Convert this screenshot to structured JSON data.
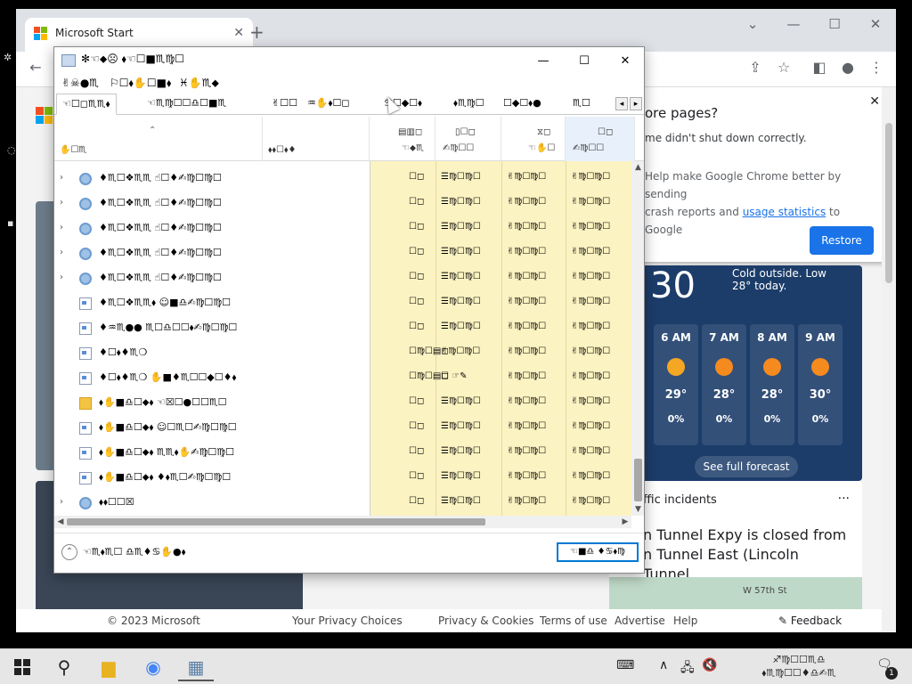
{
  "chrome": {
    "tab_title": "Microsoft Start",
    "tab_close": "✕",
    "new_tab": "+",
    "win_min": "—",
    "win_max": "☐",
    "win_close": "✕",
    "toolbar_back": "←",
    "toolbar_share": "⇪",
    "toolbar_star": "☆",
    "toolbar_sidepanel": "◧",
    "toolbar_profile": "●",
    "toolbar_menu": "⋮"
  },
  "restore_bubble": {
    "title": "ore pages?",
    "text": "me didn't shut down correctly.",
    "text2_a": "Help make Google Chrome better by sending",
    "text2_b": "crash reports and",
    "link": "usage statistics",
    "text2_c": "to Google",
    "close": "✕",
    "restore_label": "Restore"
  },
  "weather": {
    "temp": "30",
    "cold_note": "Cold outside. Low 28° today.",
    "hours": [
      {
        "label": "6 AM",
        "temp": "29°",
        "rain": "0%",
        "icon": "moon",
        "color": "#f5a623"
      },
      {
        "label": "7 AM",
        "temp": "28°",
        "rain": "0%",
        "icon": "sun",
        "color": "#f58a1f"
      },
      {
        "label": "8 AM",
        "temp": "28°",
        "rain": "0%",
        "icon": "sun",
        "color": "#f58a1f"
      },
      {
        "label": "9 AM",
        "temp": "30°",
        "rain": "0%",
        "icon": "sun",
        "color": "#f58a1f"
      }
    ],
    "forecast_label": "See full forecast"
  },
  "traffic": {
    "title": "ffic incidents",
    "dots": "···",
    "headline": "n Tunnel Expy is closed from n Tunnel East (Lincoln Tunnel...",
    "map_label": "W 57th St"
  },
  "footer": {
    "copyright": "© 2023 Microsoft",
    "privacy_choices": "Your Privacy Choices",
    "privacy_cookies": "Privacy & Cookies",
    "terms": "Terms of use",
    "advertise": "Advertise",
    "help": "Help",
    "feedback": "Feedback"
  },
  "dialog": {
    "title": "✻☜⬥☹ ⬧☜☐■♏♍☐",
    "ctrl_min": "—",
    "ctrl_max": "☐",
    "ctrl_close": "✕",
    "menu": [
      "✌☠●♏",
      "⚐☐⬧✋☐■⬧",
      "♓✋♏⬥"
    ],
    "tabs": [
      "☜☐◻♏♏⬧",
      "☜♏♍☐☐♎☐■♏",
      "✌☐☐",
      "♒✋⬧☐◻",
      "♋☐◆☐⬧",
      "⬧♏♍☐",
      "☐◆☐⬧●",
      "♏☐"
    ],
    "tab_left": "◂",
    "tab_right": "▸",
    "headers": {
      "name": "✋☐♏",
      "status": "⬧⬧☐⬧♦",
      "c1_top": "▤▥◻",
      "c1_bot": "☜⬥♏",
      "c2_top": "▯☐◻",
      "c2_bot": "✍♍☐☐",
      "c3_top": "⧖◻",
      "c3_bot": "☜✋☐",
      "c4_top": "☐◻",
      "c4_bot": "✍♍☐☐",
      "sort": "⌃"
    },
    "rows": [
      {
        "icon": "gear",
        "expand": "›",
        "name": "♦♏☐❖♏♏ ☝☐♦✍♍☐♍☐",
        "c1": "☐◻",
        "c2": "☰♍☐♍☐",
        "c3": "✌♍☐♍☐",
        "c4": "✌♍☐♍☐"
      },
      {
        "icon": "gear",
        "expand": "›",
        "name": "♦♏☐❖♏♏ ☝☐♦✍♍☐♍☐",
        "c1": "☐◻",
        "c2": "☰♍☐♍☐",
        "c3": "✌♍☐♍☐",
        "c4": "✌♍☐♍☐"
      },
      {
        "icon": "gear",
        "expand": "›",
        "name": "♦♏☐❖♏♏ ☝☐♦✍♍☐♍☐",
        "c1": "☐◻",
        "c2": "☰♍☐♍☐",
        "c3": "✌♍☐♍☐",
        "c4": "✌♍☐♍☐"
      },
      {
        "icon": "gear",
        "expand": "›",
        "name": "♦♏☐❖♏♏ ☝☐♦✍♍☐♍☐",
        "c1": "☐◻",
        "c2": "☰♍☐♍☐",
        "c3": "✌♍☐♍☐",
        "c4": "✌♍☐♍☐"
      },
      {
        "icon": "gear",
        "expand": "›",
        "name": "♦♏☐❖♏♏ ☝☐♦✍♍☐♍☐",
        "c1": "☐◻",
        "c2": "☰♍☐♍☐",
        "c3": "✌♍☐♍☐",
        "c4": "✌♍☐♍☐"
      },
      {
        "icon": "doc",
        "expand": "",
        "name": "♦♏☐❖♏♏⬧ ☺■♎✍♍☐♍☐",
        "c1": "☐◻",
        "c2": "☰♍☐♍☐",
        "c3": "✌♍☐♍☐",
        "c4": "✌♍☐♍☐"
      },
      {
        "icon": "doc",
        "expand": "",
        "name": "♦♒♏●● ♏☐♎☐☐⬧✍♍☐♍☐",
        "c1": "☐◻",
        "c2": "☰♍☐♍☐",
        "c3": "✌♍☐♍☐",
        "c4": "✌♍☐♍☐"
      },
      {
        "icon": "doc",
        "expand": "",
        "name": "♦☐⬧♦♏❍",
        "c1": "☐♍☐▤◻",
        "c2": "✌♍☐♍☐",
        "c3": "✌♍☐♍☐",
        "c4": "✌♍☐♍☐"
      },
      {
        "icon": "doc",
        "expand": "",
        "name": "♦☐⬧♦♏❍ ✋■♦♏☐☐◆☐♦⬧",
        "c1": "☐♍☐▤◻",
        "c2": "☐ ☞✎",
        "c3": "✌♍☐♍☐",
        "c4": "✌♍☐♍☐"
      },
      {
        "icon": "folder",
        "expand": "",
        "name": "⬧✋■♎☐⬥⬧ ☜☒☐●☐☐♏☐",
        "c1": "☐◻",
        "c2": "☰♍☐♍☐",
        "c3": "✌♍☐♍☐",
        "c4": "✌♍☐♍☐"
      },
      {
        "icon": "doc",
        "expand": "",
        "name": "⬧✋■♎☐⬥⬧ ☺☐♏☐✍♍☐♍☐",
        "c1": "☐◻",
        "c2": "☰♍☐♍☐",
        "c3": "✌♍☐♍☐",
        "c4": "✌♍☐♍☐"
      },
      {
        "icon": "doc",
        "expand": "",
        "name": "⬧✋■♎☐⬥⬧ ♏♏⬧✋✍♍☐♍☐",
        "c1": "☐◻",
        "c2": "☰♍☐♍☐",
        "c3": "✌♍☐♍☐",
        "c4": "✌♍☐♍☐"
      },
      {
        "icon": "doc",
        "expand": "",
        "name": "⬧✋■♎☐⬥⬧ ♦⬧♏☐✍♍☐♍☐",
        "c1": "☐◻",
        "c2": "☰♍☐♍☐",
        "c3": "✌♍☐♍☐",
        "c4": "✌♍☐♍☐"
      },
      {
        "icon": "gear",
        "expand": "›",
        "name": "⬧⬧☐☐☒",
        "c1": "☐◻",
        "c2": "☰♍☐♍☐",
        "c3": "✌♍☐♍☐",
        "c4": "✌♍☐♍☐"
      }
    ],
    "fewer_label": "☜♏⬧♏☐ ♎♏♦♋✋●⬧",
    "end_task_label": "☜■♎ ♦♋⬧♍"
  },
  "taskbar": {
    "search": "⚲",
    "folder": "▆",
    "chrome": "◉",
    "app": "▦",
    "tray_keyboard": "⌨",
    "tray_up": "∧",
    "tray_net": "🖧",
    "tray_sound": "🔇",
    "clock_top": "♐♍☐☐♏♎",
    "clock_bot": "⬧♏♍☐☐♦♎✍♏",
    "notif": "🗨",
    "notif_count": "1"
  }
}
